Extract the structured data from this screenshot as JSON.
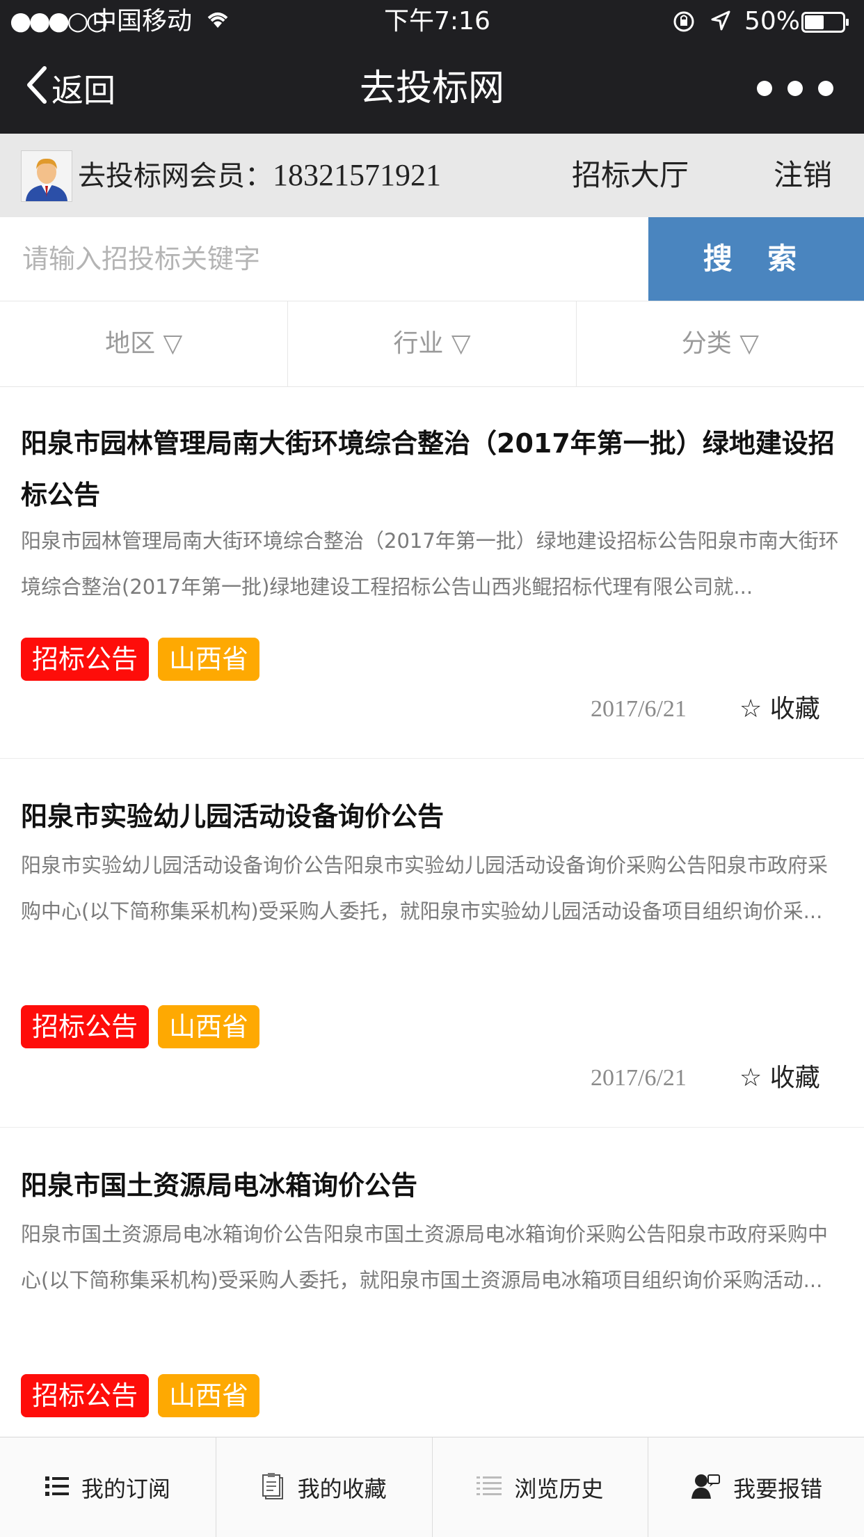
{
  "status_bar": {
    "signal": "●●●○○",
    "carrier": "中国移动",
    "time": "下午7:16",
    "battery": "50%",
    "battery_level": 0.5
  },
  "nav": {
    "back_label": "返回",
    "title": "去投标网",
    "more_icon": "more-dots-icon"
  },
  "member": {
    "label": "去投标网会员：",
    "phone": "18321571921",
    "hall_label": "招标大厅",
    "logout_label": "注销"
  },
  "search": {
    "placeholder": "请输入招投标关键字",
    "button_label": "搜 索"
  },
  "filters": [
    {
      "label": "地区 ▽"
    },
    {
      "label": "行业 ▽"
    },
    {
      "label": "分类 ▽"
    }
  ],
  "items": [
    {
      "title": "阳泉市园林管理局南大街环境综合整治（2017年第一批）绿地建设招标公告",
      "desc": "阳泉市园林管理局南大街环境综合整治（2017年第一批）绿地建设招标公告阳泉市南大街环境综合整治(2017年第一批)绿地建设工程招标公告山西兆鲲招标代理有限公司就...",
      "tags": [
        "招标公告",
        "山西省"
      ],
      "date": "2017/6/21",
      "fav_label": "☆ 收藏"
    },
    {
      "title": "阳泉市实验幼儿园活动设备询价公告",
      "desc": "阳泉市实验幼儿园活动设备询价公告阳泉市实验幼儿园活动设备询价采购公告阳泉市政府采购中心(以下简称集采机构)受采购人委托，就阳泉市实验幼儿园活动设备项目组织询价采...",
      "tags": [
        "招标公告",
        "山西省"
      ],
      "date": "2017/6/21",
      "fav_label": "☆ 收藏"
    },
    {
      "title": "阳泉市国土资源局电冰箱询价公告",
      "desc": "阳泉市国土资源局电冰箱询价公告阳泉市国土资源局电冰箱询价采购公告阳泉市政府采购中心(以下简称集采机构)受采购人委托，就阳泉市国土资源局电冰箱项目组织询价采购活动...",
      "tags": [
        "招标公告",
        "山西省"
      ]
    }
  ],
  "tabbar": [
    {
      "label": "我的订阅",
      "icon": "list-icon"
    },
    {
      "label": "我的收藏",
      "icon": "clipboard-icon"
    },
    {
      "label": "浏览历史",
      "icon": "history-list-icon"
    },
    {
      "label": "我要报错",
      "icon": "report-user-icon"
    }
  ],
  "colors": {
    "header_bg": "#1f1f22",
    "member_bar_bg": "#e8e8e8",
    "search_button": "#4a85bf",
    "tag_red": "#fe0d0a",
    "tag_orange": "#fea902"
  }
}
